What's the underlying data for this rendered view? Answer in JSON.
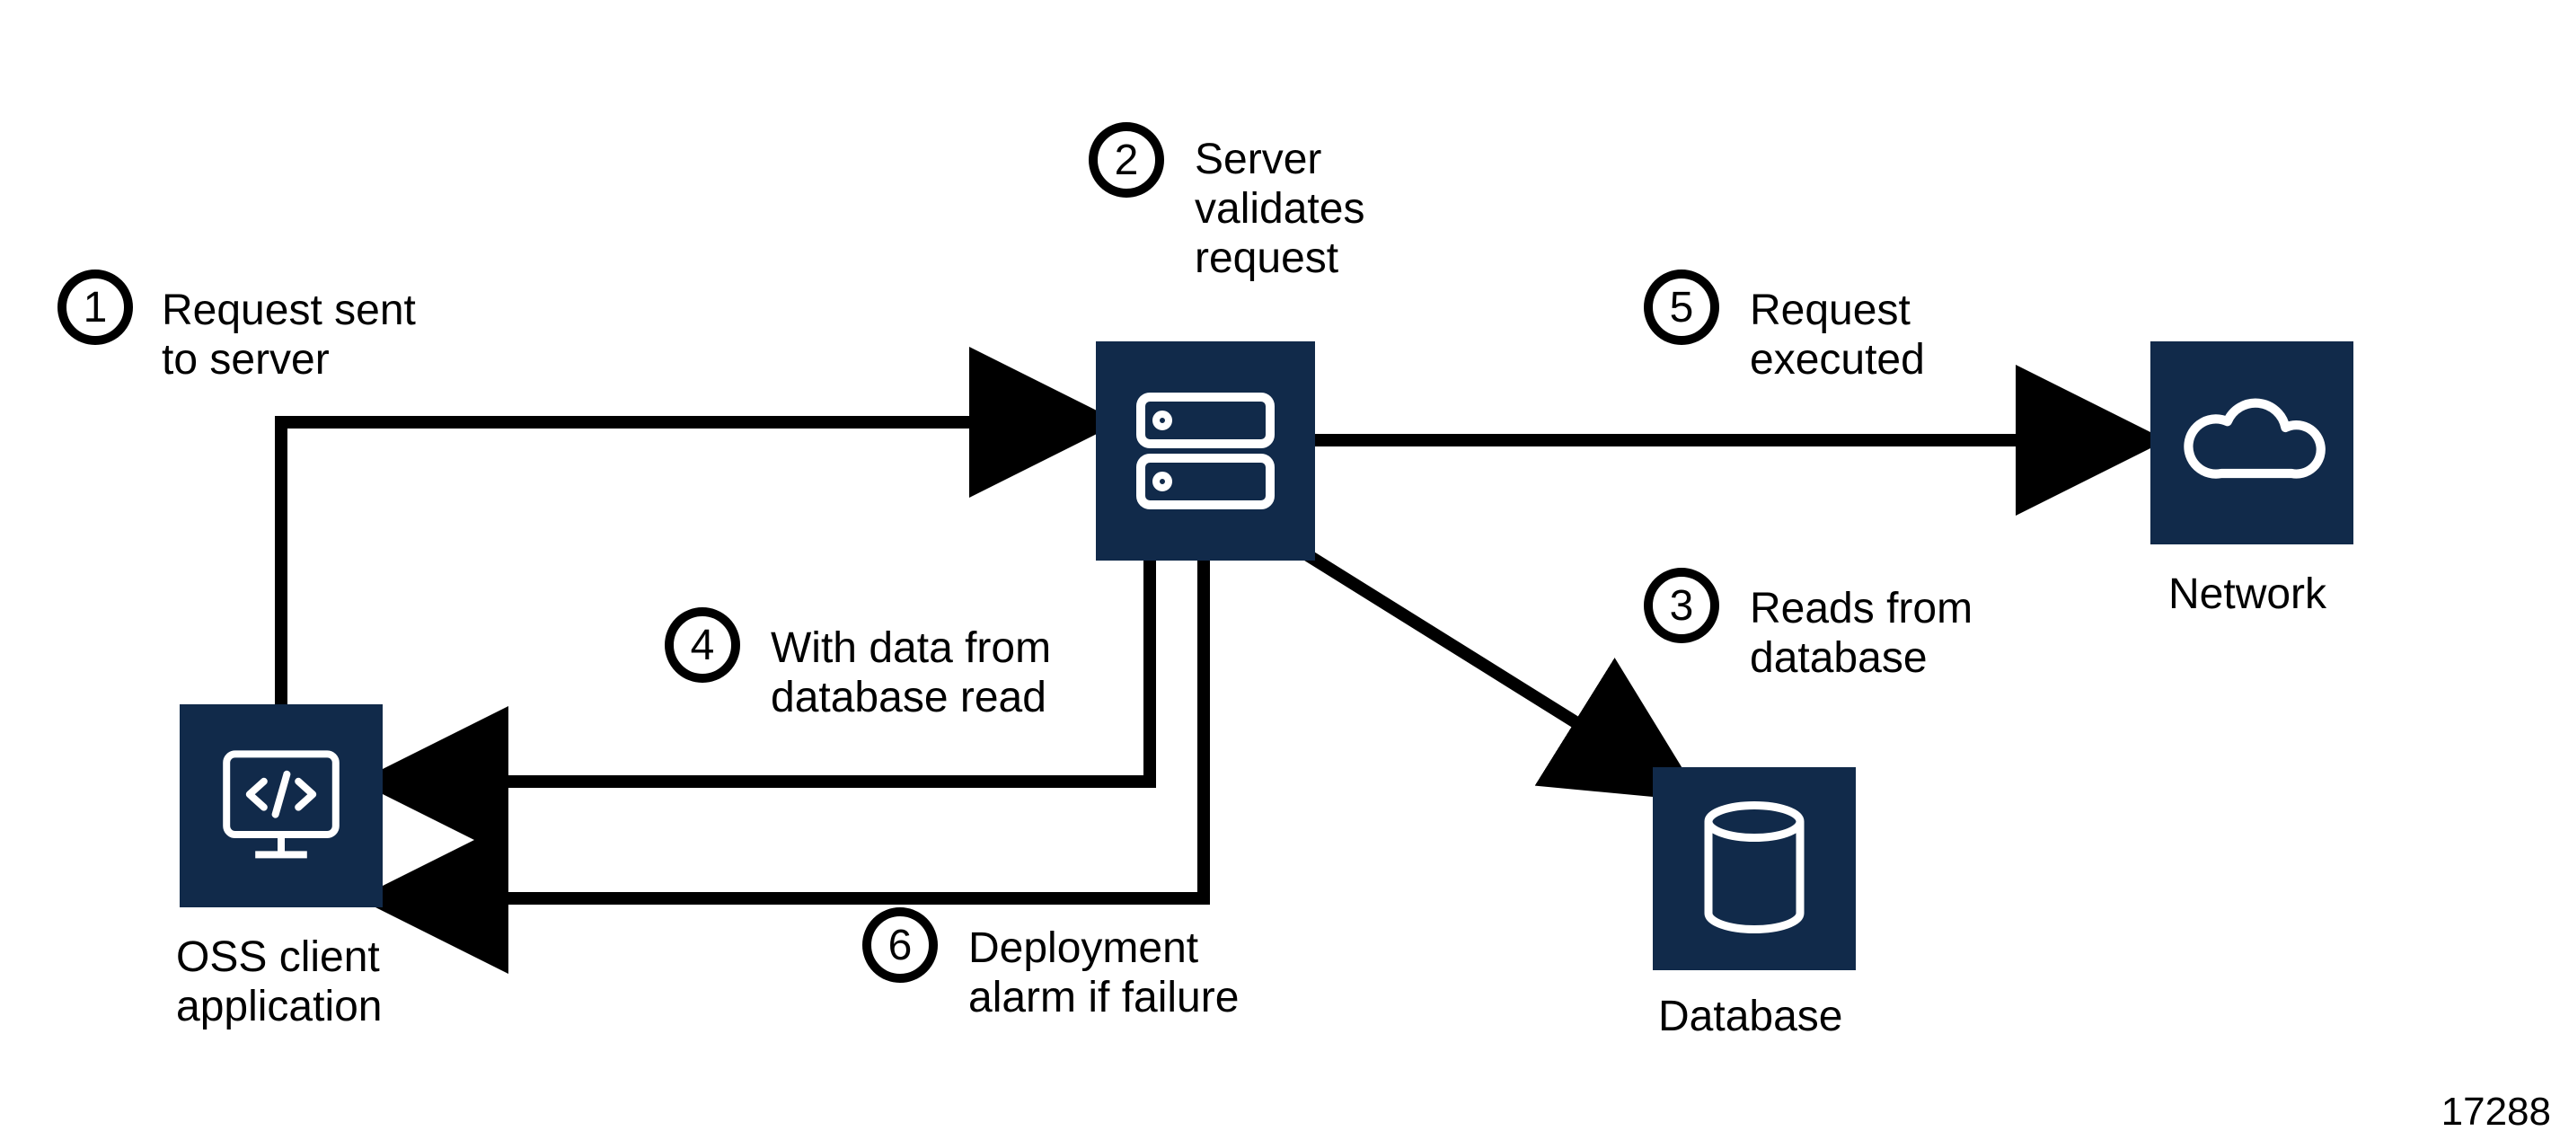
{
  "nodes": {
    "client": {
      "label": "OSS client\napplication"
    },
    "server": {
      "label": ""
    },
    "database": {
      "label": "Database"
    },
    "network": {
      "label": "Network"
    }
  },
  "steps": {
    "s1": {
      "num": "1",
      "text": "Request sent\nto server"
    },
    "s2": {
      "num": "2",
      "text": "Server\nvalidates\nrequest"
    },
    "s3": {
      "num": "3",
      "text": "Reads from\ndatabase"
    },
    "s4": {
      "num": "4",
      "text": "With data from\ndatabase read"
    },
    "s5": {
      "num": "5",
      "text": "Request\nexecuted"
    },
    "s6": {
      "num": "6",
      "text": "Deployment\nalarm if failure"
    }
  },
  "docId": "17288",
  "colors": {
    "box": "#112a4a",
    "boxStroke": "#ffffff",
    "line": "#000000"
  }
}
